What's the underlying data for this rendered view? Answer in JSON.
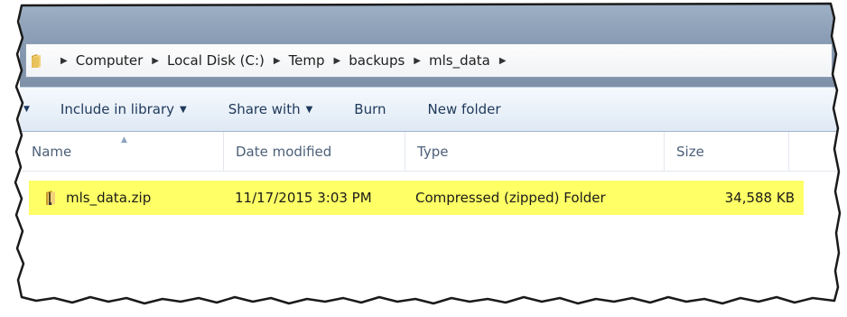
{
  "address_bar": {
    "crumbs": [
      "Computer",
      "Local Disk (C:)",
      "Temp",
      "backups",
      "mls_data"
    ]
  },
  "toolbar": {
    "include_label": "Include in library",
    "share_label": "Share with",
    "burn_label": "Burn",
    "new_folder_label": "New folder"
  },
  "columns": {
    "name": "Name",
    "date": "Date modified",
    "type": "Type",
    "size": "Size"
  },
  "files": [
    {
      "name": "mls_data.zip",
      "date": "11/17/2015 3:03 PM",
      "type": "Compressed (zipped) Folder",
      "size": "34,588 KB"
    }
  ],
  "colors": {
    "highlight": "#ffff66",
    "folder": "#e8c15a",
    "header_text": "#4c607a",
    "toolbar_text": "#1e395b"
  },
  "icons": {
    "address_folder": "folder-icon",
    "file": "zip-folder-icon"
  }
}
